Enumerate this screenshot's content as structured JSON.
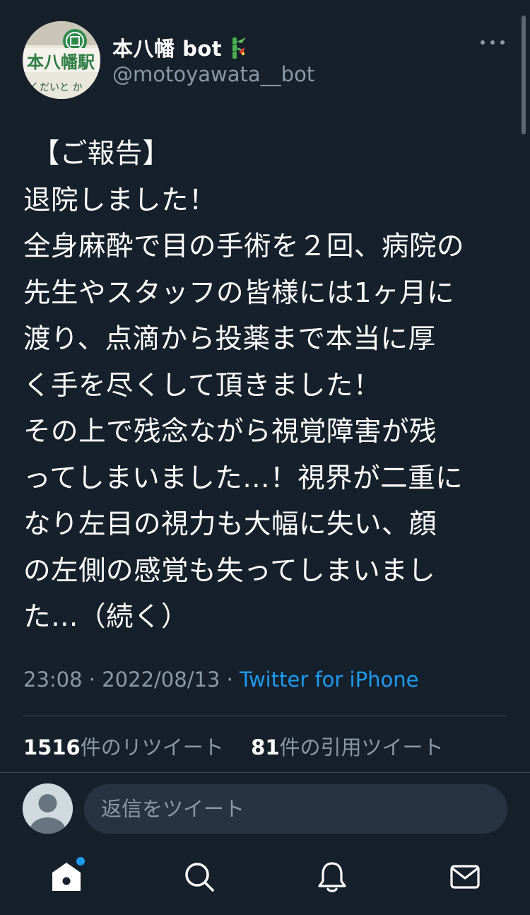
{
  "tweet": {
    "author": {
      "display_name": "本八幡 bot",
      "name_emoji": "bamboo-decoration",
      "handle": "@motoyawata__bot"
    },
    "text": " 【ご報告】\n退院しました！\n全身麻酔で目の手術を２回、病院の\n先生やスタッフの皆様には1ヶ月に\n渡り、点滴から投薬まで本当に厚\nく手を尽くして頂きました！\nその上で残念ながら視覚障害が残\nってしまいました…！視界が二重に\nなり左目の視力も大幅に失い、顔\nの左側の感覚も失ってしまいまし\nた…（続く）",
    "time": "23:08",
    "date": "2022/08/13",
    "separator": "·",
    "source": "Twitter for iPhone",
    "retweets_count": "1516",
    "retweets_label": "件のリツイート",
    "quotes_count": "81",
    "quotes_label": "件の引用ツイート"
  },
  "reply": {
    "placeholder": "返信をツイート"
  },
  "tabbar": {
    "items": [
      {
        "icon": "home-icon",
        "active": true,
        "has_notification": true
      },
      {
        "icon": "search-icon",
        "active": false
      },
      {
        "icon": "bell-icon",
        "active": false
      },
      {
        "icon": "mail-icon",
        "active": false
      }
    ]
  },
  "colors": {
    "background": "#15202b",
    "text": "#ffffff",
    "secondary": "#8b98a5",
    "accent": "#1d9bf0",
    "divider": "#38444d"
  }
}
